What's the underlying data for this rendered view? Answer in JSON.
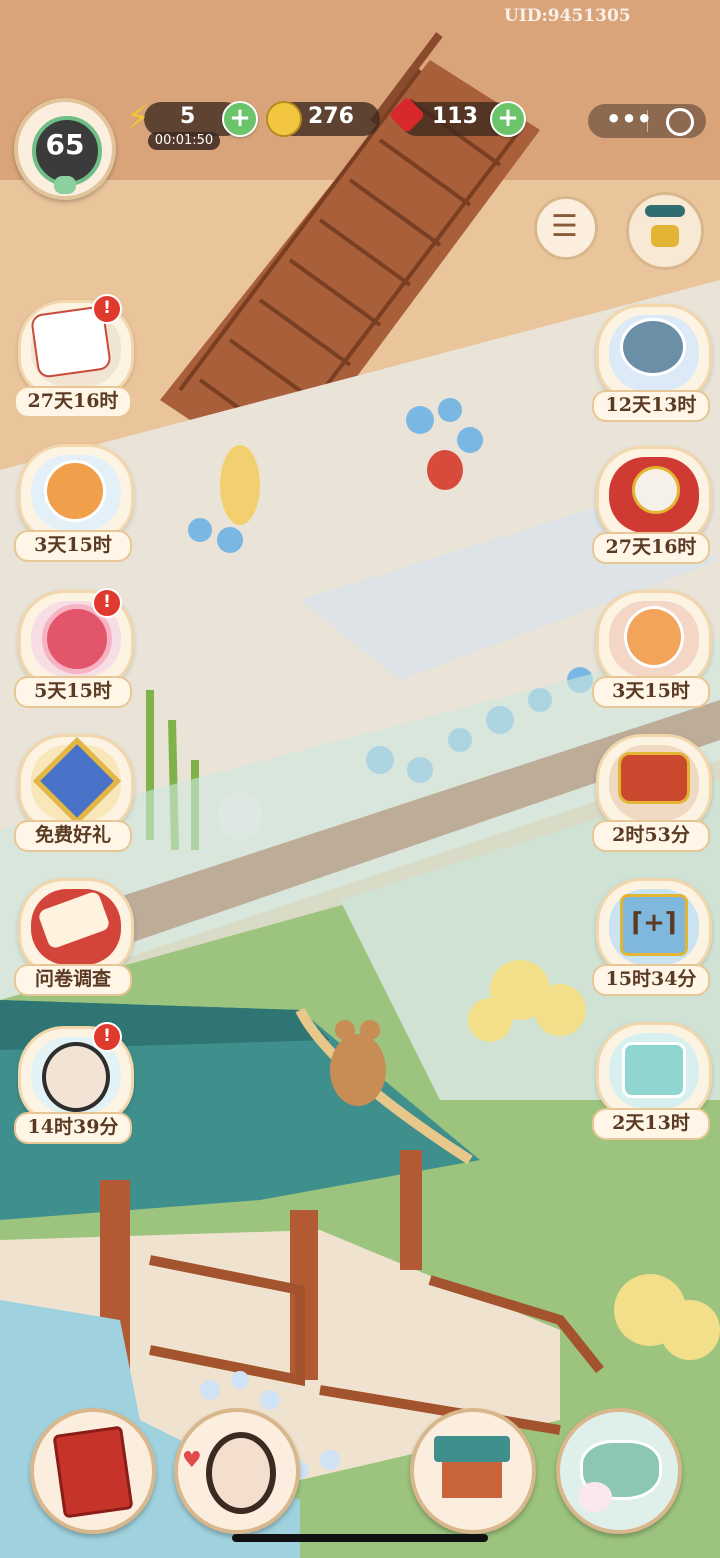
{
  "uid": "UID:9451305",
  "player": {
    "level": "65"
  },
  "resources": {
    "energy": {
      "value": "5",
      "timer": "00:01:50"
    },
    "coins": {
      "value": "276"
    },
    "gems": {
      "value": "113"
    }
  },
  "left_events": [
    {
      "label": "27天16时",
      "icon": "scroll-fan-icon",
      "alert": "!"
    },
    {
      "label": "3天15时",
      "icon": "fox-icon",
      "alert": ""
    },
    {
      "label": "5天15时",
      "icon": "red-fan-icon",
      "alert": "!"
    },
    {
      "label": "免费好礼",
      "icon": "gift-knot-icon",
      "alert": ""
    },
    {
      "label": "问卷调查",
      "icon": "survey-scroll-icon",
      "alert": ""
    },
    {
      "label": "14时39分",
      "icon": "character-portrait-icon",
      "alert": "!"
    }
  ],
  "right_events": [
    {
      "label": "12天13时",
      "icon": "cat-cloud-icon"
    },
    {
      "label": "27天16时",
      "icon": "red-fan-scroll-icon"
    },
    {
      "label": "3天15时",
      "icon": "lucky-cat-icon"
    },
    {
      "label": "2时53分",
      "icon": "treasure-chest-icon"
    },
    {
      "label": "15时34分",
      "icon": "double-bonus-icon"
    },
    {
      "label": "2天13时",
      "icon": "jade-cat-gift-icon"
    }
  ],
  "menu_icon": "list-menu-icon",
  "shop_icon": "gong-shop-icon",
  "bottom_buttons": [
    {
      "name": "journal-book-button",
      "icon": "red-book-icon"
    },
    {
      "name": "character-button",
      "icon": "lady-portrait-icon"
    },
    {
      "name": "pavilion-build-button",
      "icon": "pavilion-icon"
    },
    {
      "name": "teapot-button",
      "icon": "teapot-icon"
    }
  ],
  "colors": {
    "accent_green": "#6cc46a",
    "alert_red": "#e03a2e",
    "label_text": "#5a3a22"
  }
}
